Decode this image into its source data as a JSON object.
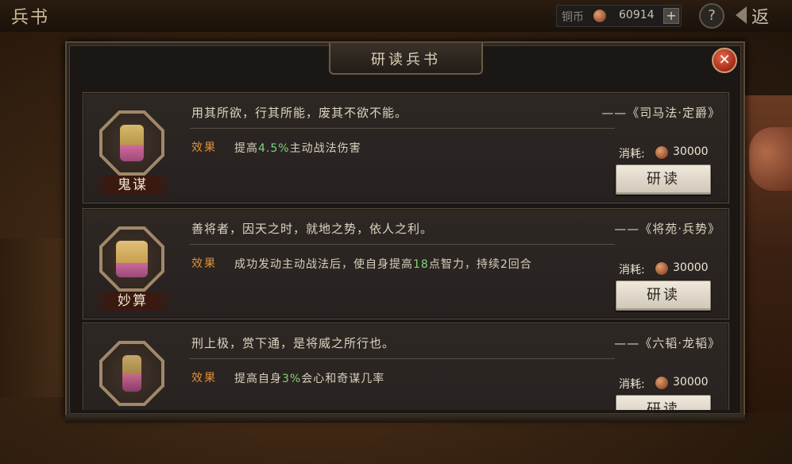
{
  "header": {
    "page_title": "兵书",
    "currency_label": "铜币",
    "currency_value": "60914",
    "plus_symbol": "+",
    "help_symbol": "?",
    "back_label": "返"
  },
  "dialog": {
    "title": "研读兵书",
    "close_symbol": "✕",
    "effect_label": "效果",
    "cost_label": "消耗:",
    "study_button_label": "研读"
  },
  "cards": [
    {
      "name": "鬼谋",
      "quote": "用其所欲，行其所能，废其不欲不能。",
      "source": "——《司马法·定爵》",
      "effect_pre": "提高",
      "effect_value": "4.5%",
      "effect_post": "主动战法伤害",
      "cost": "30000"
    },
    {
      "name": "妙算",
      "quote": "善将者，因天之时，就地之势，依人之利。",
      "source": "——《将苑·兵势》",
      "effect_pre": "成功发动主动战法后，使自身提高",
      "effect_value": "18",
      "effect_post": "点智力，持续2回合",
      "cost": "30000"
    },
    {
      "name": "",
      "quote": "刑上极，赏下通，是将威之所行也。",
      "source": "——《六韬·龙韬》",
      "effect_pre": "提高自身",
      "effect_value": "3%",
      "effect_post": "会心和奇谋几率",
      "cost": "30000"
    }
  ],
  "colors": {
    "effect_label": "#e0903a",
    "highlight_value": "#7fd47a",
    "close_button": "#a82818"
  },
  "icons": [
    "coin-icon",
    "plus-icon",
    "help-icon",
    "back-arrow-icon",
    "close-icon",
    "emblem-icon"
  ]
}
